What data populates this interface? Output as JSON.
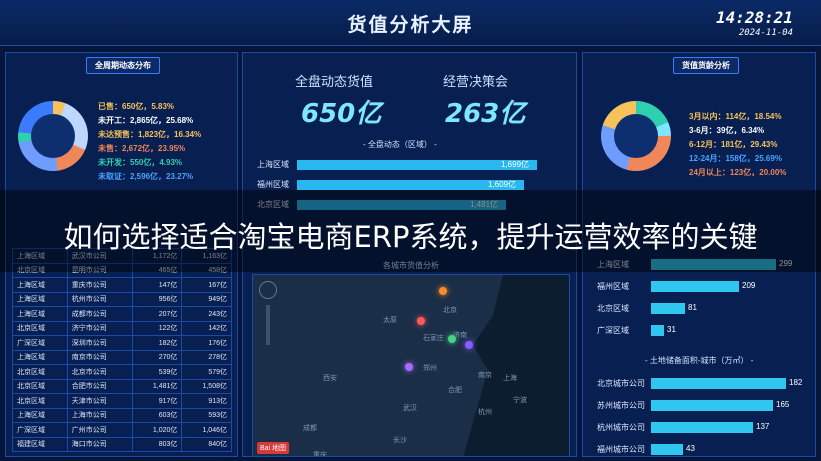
{
  "header": {
    "title": "货值分析大屏",
    "time": "14:28:21",
    "date": "2024-11-04"
  },
  "left_panel": {
    "tag": "全周期动态分布",
    "legend": [
      {
        "text": "已售：650亿，5.83%",
        "color": "#f6c35a"
      },
      {
        "text": "未开工：2,865亿，25.68%",
        "color": "#ffffff"
      },
      {
        "text": "未达预售：1,823亿，16.34%",
        "color": "#f6c35a"
      },
      {
        "text": "未售：2,672亿，23.95%",
        "color": "#f0875a"
      },
      {
        "text": "未开发：550亿，4.93%",
        "color": "#2fd0b0"
      },
      {
        "text": "未取证：2,596亿，23.27%",
        "color": "#4aa3ff"
      }
    ],
    "donut": [
      {
        "value": 5.83,
        "color": "#f6c35a"
      },
      {
        "value": 25.68,
        "color": "#bcd8ff"
      },
      {
        "value": 16.34,
        "color": "#f0875a"
      },
      {
        "value": 23.95,
        "color": "#6f9cff"
      },
      {
        "value": 4.93,
        "color": "#2fd0b0"
      },
      {
        "value": 23.27,
        "color": "#3a7bff"
      }
    ],
    "table": [
      [
        "上海区域",
        "武汉市公司",
        "1,172亿",
        "1,163亿"
      ],
      [
        "北京区域",
        "昆明市公司",
        "465亿",
        "458亿"
      ],
      [
        "上海区域",
        "重庆市公司",
        "147亿",
        "167亿"
      ],
      [
        "上海区域",
        "杭州市公司",
        "956亿",
        "949亿"
      ],
      [
        "上海区域",
        "成都市公司",
        "207亿",
        "243亿"
      ],
      [
        "北京区域",
        "济宁市公司",
        "122亿",
        "142亿"
      ],
      [
        "广深区域",
        "深圳市公司",
        "182亿",
        "176亿"
      ],
      [
        "上海区域",
        "南京市公司",
        "270亿",
        "278亿"
      ],
      [
        "北京区域",
        "北京市公司",
        "539亿",
        "579亿"
      ],
      [
        "北京区域",
        "合肥市公司",
        "1,481亿",
        "1,508亿"
      ],
      [
        "北京区域",
        "天津市公司",
        "917亿",
        "913亿"
      ],
      [
        "上海区域",
        "上海市公司",
        "603亿",
        "593亿"
      ],
      [
        "广深区域",
        "广州市公司",
        "1,020亿",
        "1,046亿"
      ],
      [
        "福建区域",
        "海口市公司",
        "803亿",
        "840亿"
      ]
    ]
  },
  "center_panel": {
    "kpi_left_label": "全盘动态货值",
    "kpi_left_value": "650亿",
    "kpi_right_label": "经营决策会",
    "kpi_right_value": "263亿",
    "bars_title": "- 全盘动态（区域） -",
    "bars": [
      {
        "label": "上海区域",
        "value": "1,699亿",
        "pct": 100
      },
      {
        "label": "福州区域",
        "value": "1,609亿",
        "pct": 94.7
      },
      {
        "label": "北京区域",
        "value": "1,481亿",
        "pct": 87.2
      }
    ],
    "map_title": "各城市货值分析",
    "map_cities": [
      "北京",
      "太原",
      "石家庄",
      "郑州",
      "西安",
      "武汉",
      "南京",
      "杭州",
      "成都",
      "重庆",
      "长沙",
      "合肥",
      "济南",
      "上海",
      "宁波"
    ]
  },
  "right_panel": {
    "tag": "货值货龄分析",
    "legend": [
      {
        "text": "3月以内：114亿，18.54%",
        "color": "#f6c35a"
      },
      {
        "text": "3-6月：39亿，6.34%",
        "color": "#ffffff"
      },
      {
        "text": "6-12月：181亿，29.43%",
        "color": "#f6c35a"
      },
      {
        "text": "12-24月：158亿，25.69%",
        "color": "#4aa3ff"
      },
      {
        "text": "24月以上：123亿，20.00%",
        "color": "#f0875a"
      }
    ],
    "donut": [
      {
        "value": 18.54,
        "color": "#2fd0b0"
      },
      {
        "value": 6.34,
        "color": "#7fe6ff"
      },
      {
        "value": 29.43,
        "color": "#f0875a"
      },
      {
        "value": 25.69,
        "color": "#6f9cff"
      },
      {
        "value": 20.0,
        "color": "#f6c35a"
      }
    ],
    "region_bars": [
      {
        "label": "上海区域",
        "value": "299",
        "pct": 100
      },
      {
        "label": "福州区域",
        "value": "209",
        "pct": 70
      },
      {
        "label": "北京区域",
        "value": "81",
        "pct": 27
      },
      {
        "label": "广深区域",
        "value": "31",
        "pct": 10
      }
    ],
    "land_title": "- 土地储备面积-城市（万㎡） -",
    "land_bars": [
      {
        "label": "北京城市公司",
        "value": "182",
        "pct": 100
      },
      {
        "label": "苏州城市公司",
        "value": "165",
        "pct": 90.7
      },
      {
        "label": "杭州城市公司",
        "value": "137",
        "pct": 75.3
      },
      {
        "label": "福州城市公司",
        "value": "43",
        "pct": 23.6
      }
    ]
  },
  "overlay": {
    "text": "如何选择适合淘宝电商ERP系统，提升运营效率的关键"
  }
}
